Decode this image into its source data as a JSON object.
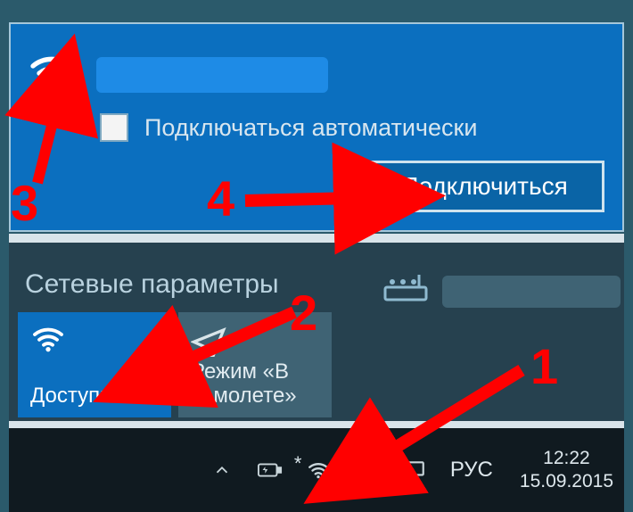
{
  "network": {
    "auto_connect_label": "Подключаться автоматически",
    "connect_button": "Подключиться"
  },
  "settings": {
    "title": "Сетевые параметры"
  },
  "tiles": {
    "wifi_label": "Доступно",
    "airplane_label": "Режим «В самолете»"
  },
  "annotations": {
    "n1": "1",
    "n2": "2",
    "n3": "3",
    "n4": "4"
  },
  "tray": {
    "lang": "РУС",
    "time": "12:22",
    "date": "15.09.2015"
  }
}
